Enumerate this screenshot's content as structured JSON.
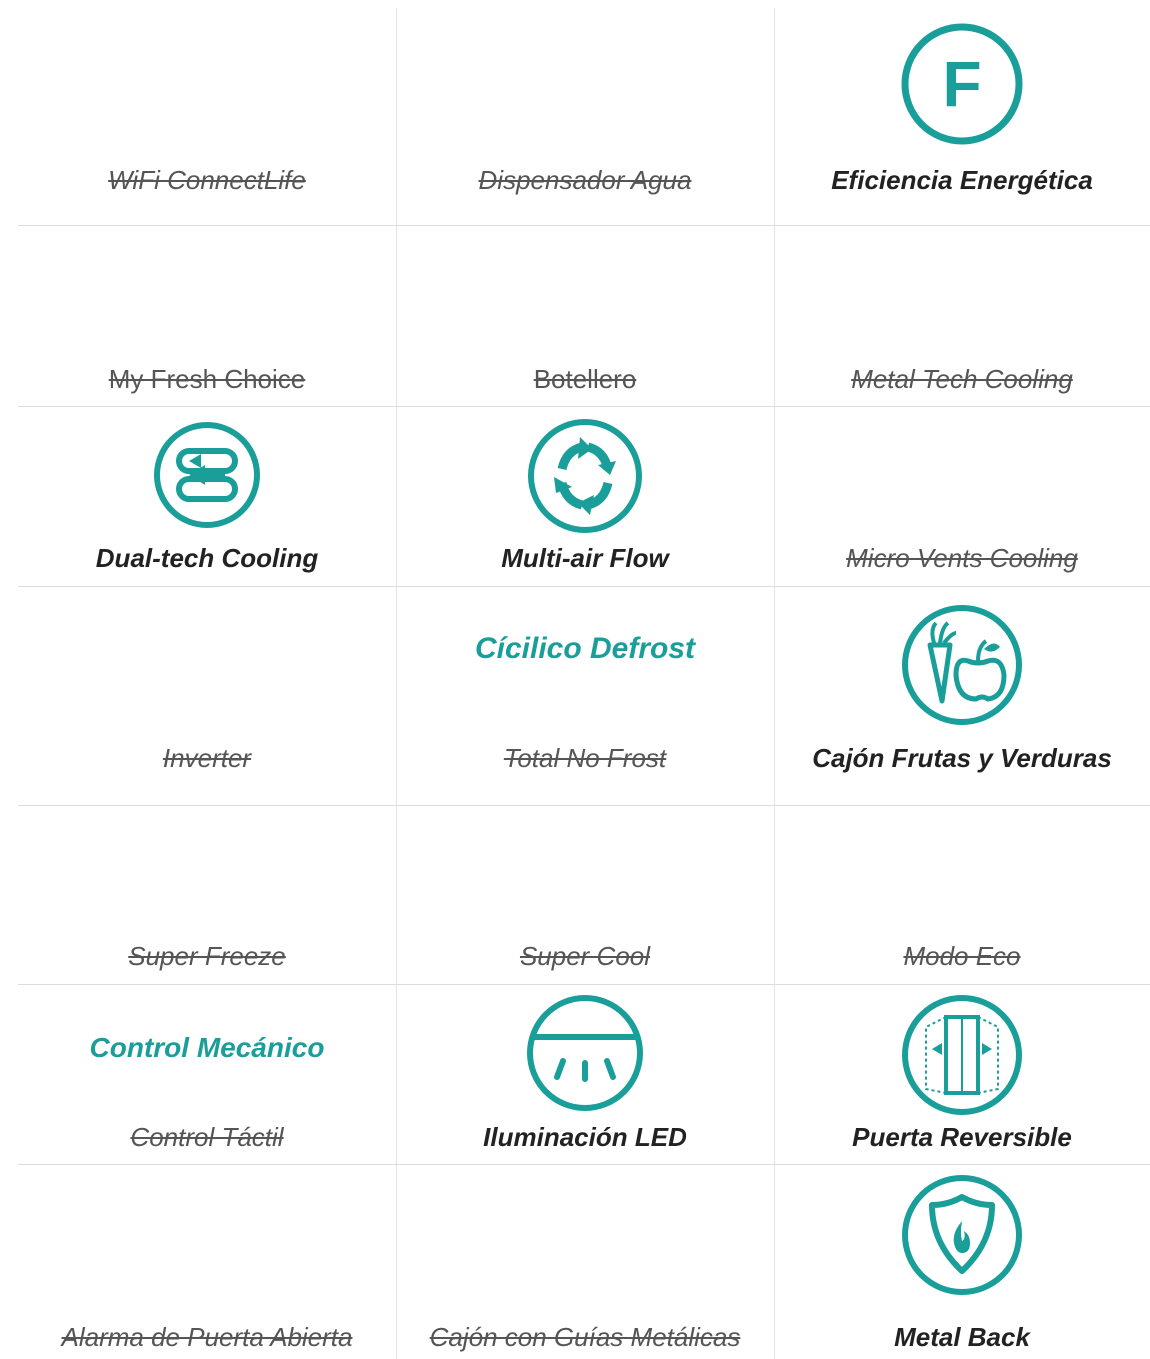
{
  "colors": {
    "accent": "#1a9e9a",
    "text": "#222222",
    "struck_text": "#555555",
    "divider": "#dcdcdc"
  },
  "features": [
    {
      "label": "WiFi ConnectLife",
      "status": "unavailable"
    },
    {
      "label": "Dispensador Agua",
      "status": "unavailable"
    },
    {
      "label": "Eficiencia Energética",
      "status": "available",
      "icon": "energy-class-f-icon",
      "icon_text": "F"
    },
    {
      "label": "My Fresh Choice",
      "status": "unavailable"
    },
    {
      "label": "Botellero",
      "status": "unavailable"
    },
    {
      "label": "Metal Tech Cooling",
      "status": "unavailable"
    },
    {
      "label": "Dual-tech Cooling",
      "status": "available",
      "icon": "dual-tech-cooling-icon"
    },
    {
      "label": "Multi-air Flow",
      "status": "available",
      "icon": "multi-air-flow-icon"
    },
    {
      "label": "Micro Vents Cooling",
      "status": "unavailable"
    },
    {
      "label": "Inverter",
      "status": "unavailable"
    },
    {
      "label": "Total No Frost",
      "status": "unavailable",
      "highlight": "Cícilico Defrost"
    },
    {
      "label": "Cajón Frutas y Verduras",
      "status": "available",
      "icon": "fruit-vegetable-drawer-icon"
    },
    {
      "label": "Super Freeze",
      "status": "unavailable"
    },
    {
      "label": "Super Cool",
      "status": "unavailable"
    },
    {
      "label": "Modo Eco",
      "status": "unavailable"
    },
    {
      "label": "Control Táctil",
      "status": "unavailable",
      "highlight": "Control Mecánico"
    },
    {
      "label": "Iluminación LED",
      "status": "available",
      "icon": "led-lighting-icon"
    },
    {
      "label": "Puerta Reversible",
      "status": "available",
      "icon": "reversible-door-icon"
    },
    {
      "label": "Alarma de Puerta Abierta",
      "status": "unavailable"
    },
    {
      "label": "Cajón con Guías Metálicas",
      "status": "unavailable"
    },
    {
      "label": "Metal Back",
      "status": "available",
      "icon": "metal-back-shield-icon"
    }
  ]
}
